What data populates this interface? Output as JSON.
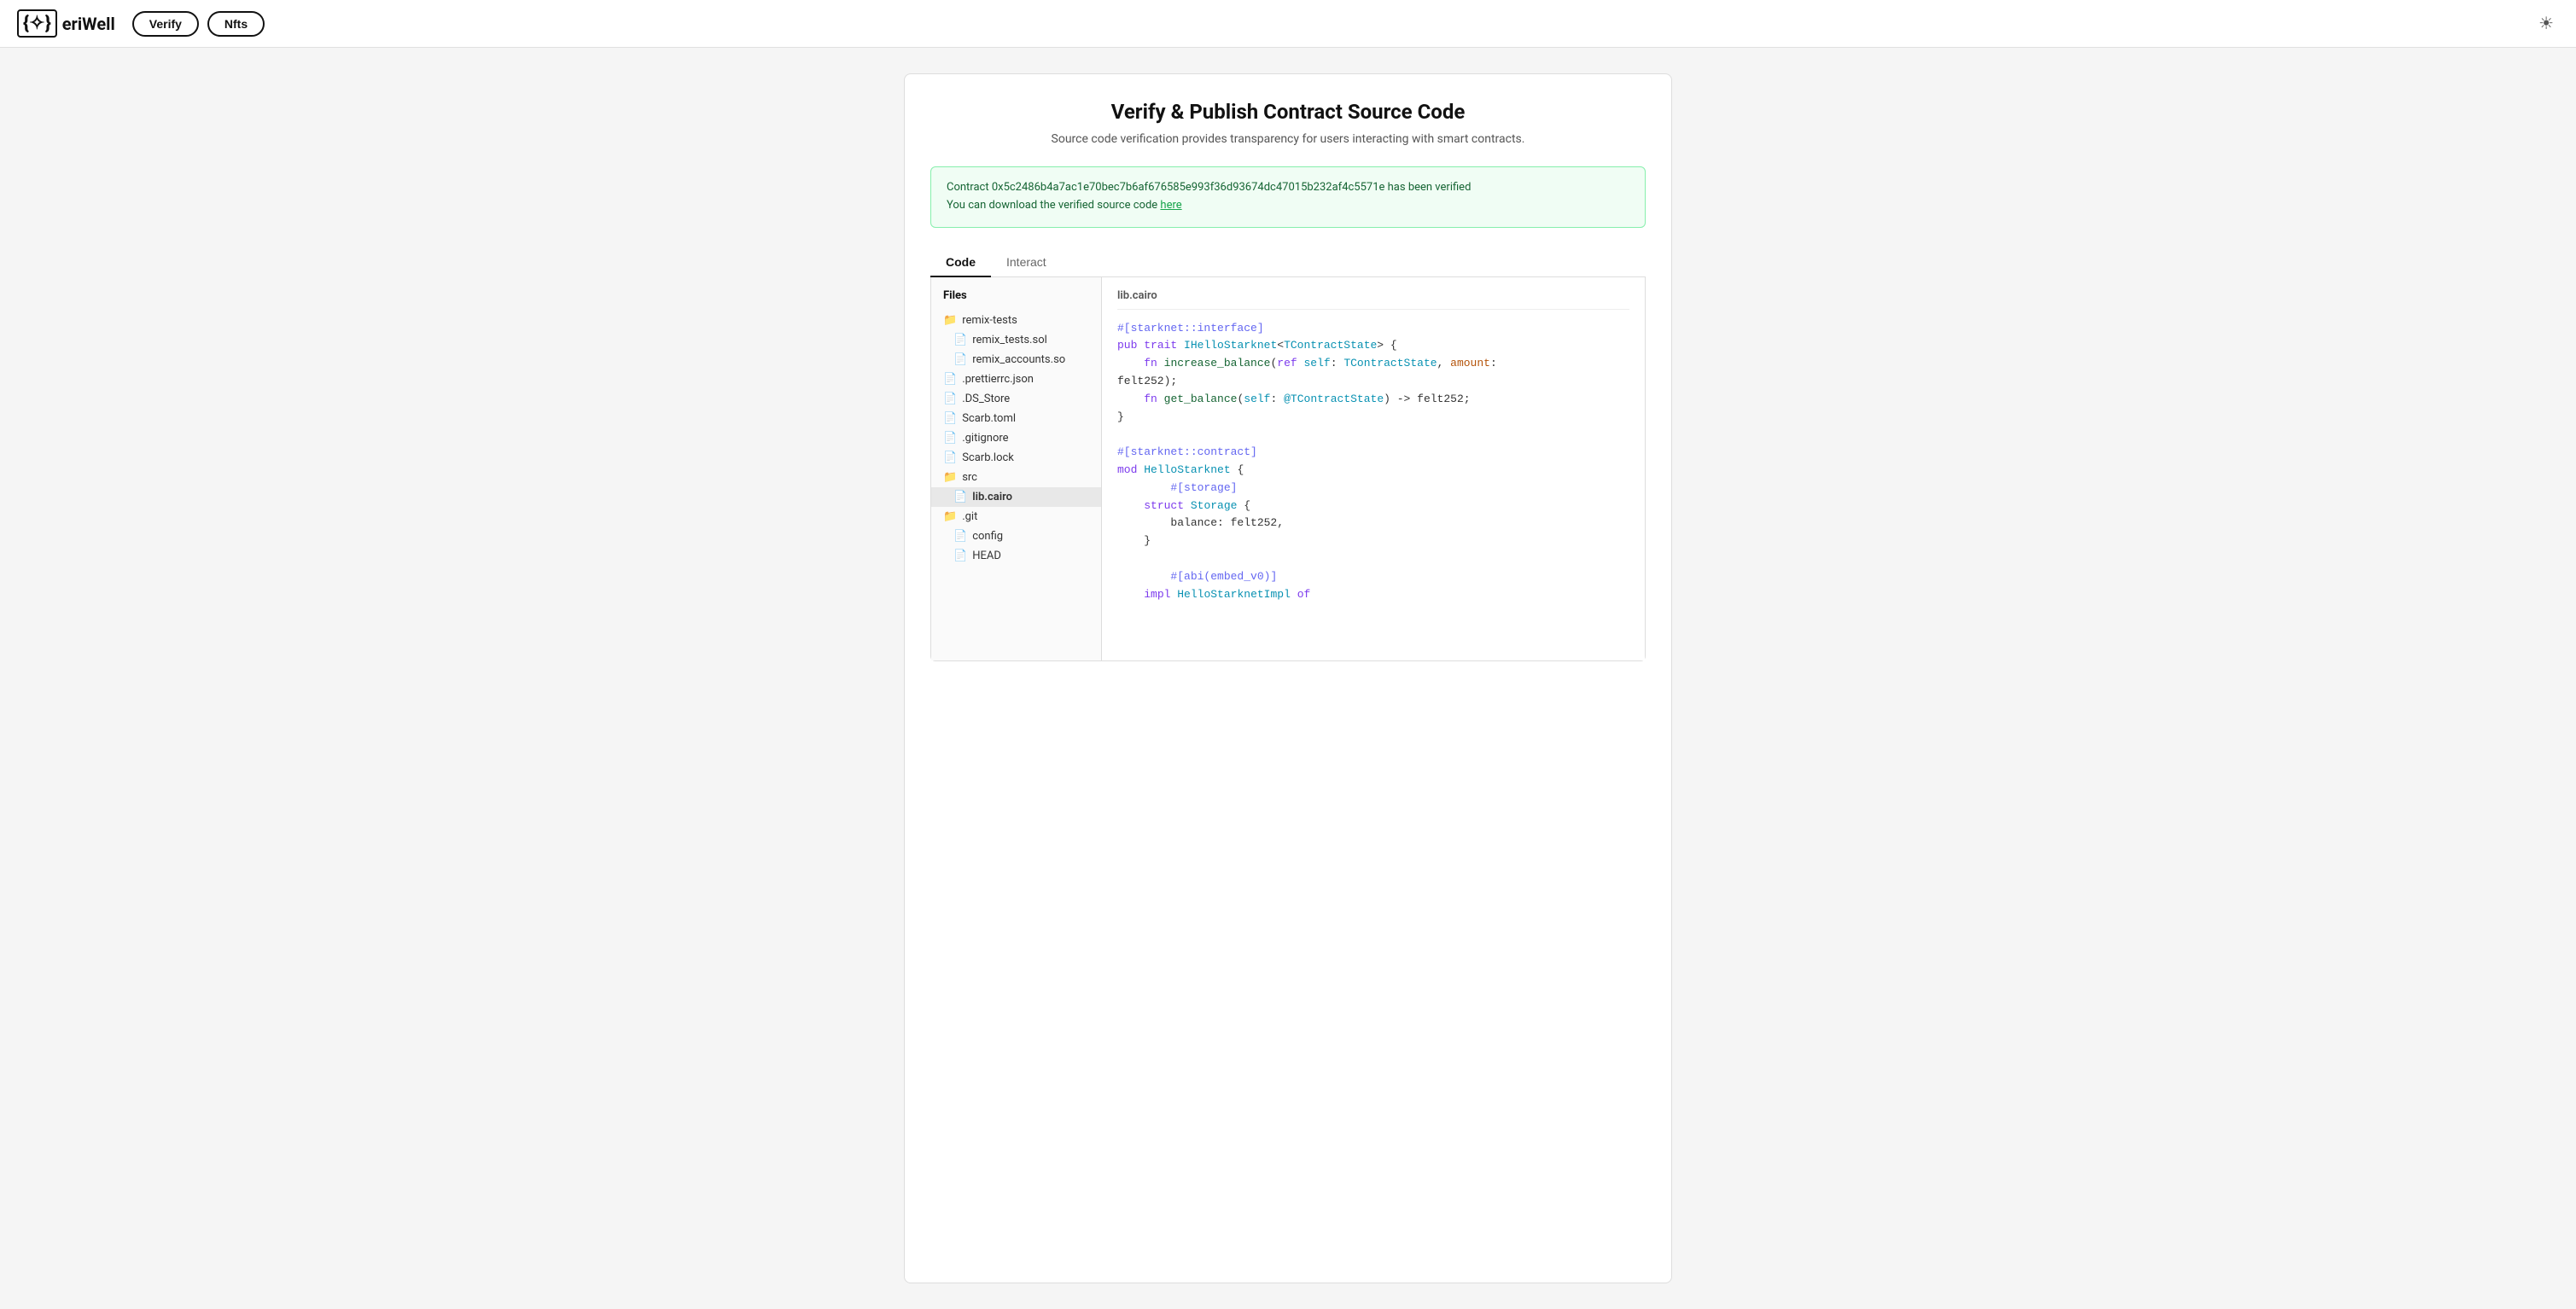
{
  "header": {
    "logo_icon": "{✧}",
    "logo_text": "eriWell",
    "nav_items": [
      "Verify",
      "Nfts"
    ],
    "theme_icon": "☀"
  },
  "page": {
    "title": "Verify & Publish Contract Source Code",
    "subtitle": "Source code verification provides transparency for users interacting with smart contracts.",
    "success_message_1": "Contract 0x5c2486b4a7ac1e70bec7b6af676585e993f36d93674dc47015b232af4c5571e has been verified",
    "success_message_2": "You can download the verified source code ",
    "success_link_text": "here",
    "tabs": [
      "Code",
      "Interact"
    ],
    "active_tab": "Code"
  },
  "file_tree": {
    "title": "Files",
    "items": [
      {
        "label": "remix-tests",
        "indent": 0,
        "type": "folder"
      },
      {
        "label": "remix_tests.sol",
        "indent": 1,
        "type": "file"
      },
      {
        "label": "remix_accounts.so",
        "indent": 1,
        "type": "file"
      },
      {
        "label": ".prettierrc.json",
        "indent": 0,
        "type": "file"
      },
      {
        "label": ".DS_Store",
        "indent": 0,
        "type": "file"
      },
      {
        "label": "Scarb.toml",
        "indent": 0,
        "type": "file"
      },
      {
        "label": ".gitignore",
        "indent": 0,
        "type": "file"
      },
      {
        "label": "Scarb.lock",
        "indent": 0,
        "type": "file"
      },
      {
        "label": "src",
        "indent": 0,
        "type": "folder"
      },
      {
        "label": "lib.cairo",
        "indent": 1,
        "type": "file",
        "selected": true
      },
      {
        "label": ".git",
        "indent": 0,
        "type": "folder"
      },
      {
        "label": "config",
        "indent": 1,
        "type": "file"
      },
      {
        "label": "HEAD",
        "indent": 1,
        "type": "file"
      }
    ]
  },
  "code": {
    "filename": "lib.cairo",
    "lines": [
      {
        "text": "#[starknet::interface]",
        "type": "attr"
      },
      {
        "text": "pub trait IHelloStarknet<TContractState> {",
        "type": "mixed"
      },
      {
        "text": "    fn increase_balance(ref self: TContractState, amount:",
        "type": "mixed"
      },
      {
        "text": "felt252);",
        "type": "plain"
      },
      {
        "text": "    fn get_balance(self: @TContractState) -> felt252;",
        "type": "mixed"
      },
      {
        "text": "}",
        "type": "plain"
      },
      {
        "text": "",
        "type": "blank"
      },
      {
        "text": "#[starknet::contract]",
        "type": "attr"
      },
      {
        "text": "mod HelloStarknet {",
        "type": "mixed"
      },
      {
        "text": "    #[storage]",
        "type": "attr"
      },
      {
        "text": "    struct Storage {",
        "type": "mixed"
      },
      {
        "text": "        balance: felt252,",
        "type": "plain"
      },
      {
        "text": "    }",
        "type": "plain"
      },
      {
        "text": "",
        "type": "blank"
      },
      {
        "text": "    #[abi(embed_v0)]",
        "type": "attr"
      },
      {
        "text": "    impl HelloStarknetImpl of",
        "type": "mixed"
      }
    ]
  }
}
